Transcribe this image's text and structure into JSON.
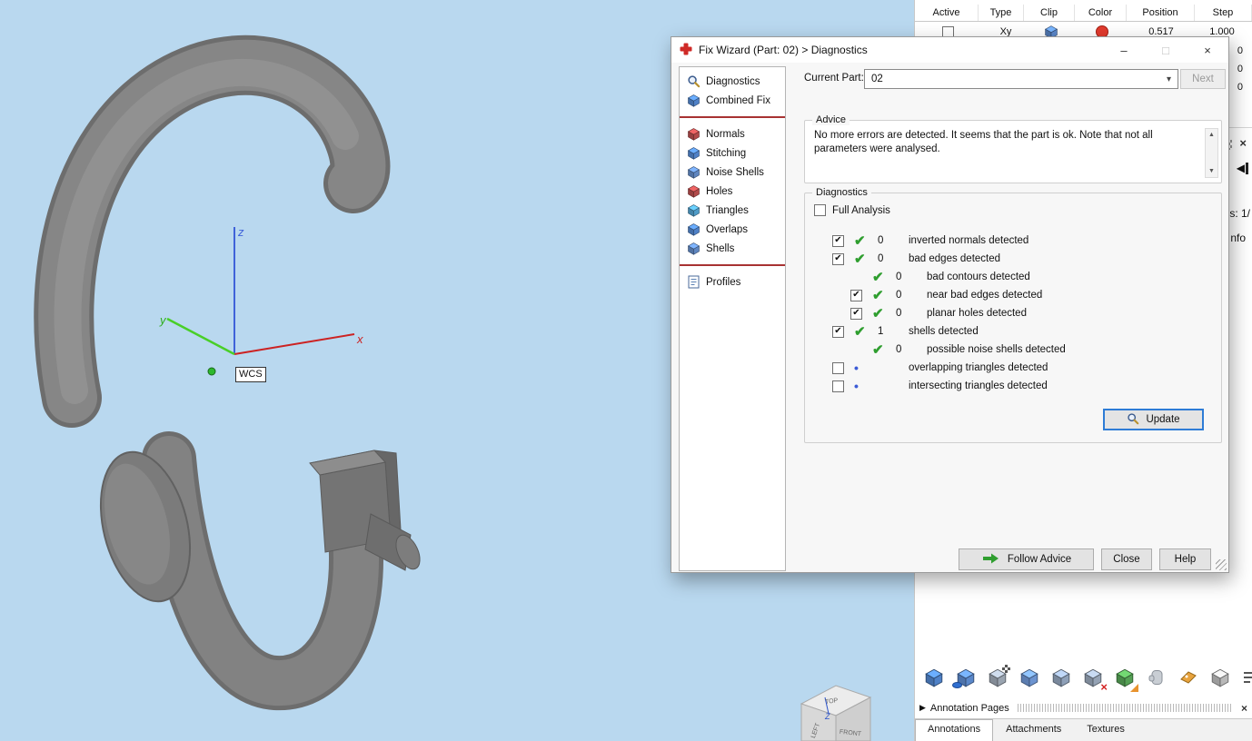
{
  "glyphs": {
    "check": "✔",
    "dot": "•",
    "arrow_left": "◀",
    "close": "×",
    "minimize": "–",
    "maximize": "□",
    "chevron_down": "▾",
    "scroll_up": "▲",
    "scroll_down": "▼",
    "expand_right": "▶"
  },
  "colors": {
    "viewport_bg": "#b9d8ef",
    "accent_blue": "#2e7cd6",
    "check_green": "#2f9e2f",
    "dot_blue": "#3b5bd6",
    "axis_x": "#cc2222",
    "axis_y": "#2fae1f",
    "axis_z": "#3f62d9",
    "swatch_red": "#e23b2e",
    "separator_red": "#a83232",
    "model_gray": "#868686"
  },
  "viewport": {
    "wcs_label": "WCS",
    "axes": {
      "x": "x",
      "y": "y",
      "z": "z"
    },
    "view_cube": {
      "top": "TOP",
      "left": "LEFT",
      "front": "FRONT",
      "z_axis": "Z"
    }
  },
  "dialog": {
    "title": "Fix Wizard (Part: 02) > Diagnostics",
    "current_part": {
      "label": "Current Part:",
      "value": "02"
    },
    "next_button": "Next",
    "sidebar": {
      "top": [
        {
          "label": "Diagnostics",
          "icon": "magnifier-icon"
        },
        {
          "label": "Combined Fix",
          "icon": "combined-fix-icon",
          "color": "#4f81c7"
        }
      ],
      "middle": [
        {
          "label": "Normals",
          "icon": "normals-icon",
          "color": "#b24a4a"
        },
        {
          "label": "Stitching",
          "icon": "stitching-icon",
          "color": "#4f81c7"
        },
        {
          "label": "Noise Shells",
          "icon": "noise-shells-icon",
          "color": "#5f86c0"
        },
        {
          "label": "Holes",
          "icon": "holes-icon",
          "color": "#b24a4a"
        },
        {
          "label": "Triangles",
          "icon": "triangles-icon",
          "color": "#4f9bc7"
        },
        {
          "label": "Overlaps",
          "icon": "overlaps-icon",
          "color": "#4f81c7"
        },
        {
          "label": "Shells",
          "icon": "shells-icon",
          "color": "#5f86c0"
        }
      ],
      "bottom": [
        {
          "label": "Profiles",
          "icon": "profiles-icon"
        }
      ]
    },
    "advice": {
      "legend": "Advice",
      "text": "No more errors are detected. It seems that the part is ok. Note that not all parameters were analysed."
    },
    "diagnostics": {
      "legend": "Diagnostics",
      "full_analysis": "Full Analysis",
      "rows": [
        {
          "checkbox": "checked",
          "mark": "check",
          "count": "0",
          "label": "inverted normals detected",
          "indent": 0
        },
        {
          "checkbox": "checked",
          "mark": "check",
          "count": "0",
          "label": "bad edges detected",
          "indent": 0
        },
        {
          "checkbox": "none",
          "mark": "check",
          "count": "0",
          "label": "bad contours detected",
          "indent": 1
        },
        {
          "checkbox": "checked",
          "mark": "check",
          "count": "0",
          "label": "near bad edges detected",
          "indent": 1
        },
        {
          "checkbox": "checked",
          "mark": "check",
          "count": "0",
          "label": "planar holes detected",
          "indent": 1
        },
        {
          "checkbox": "checked",
          "mark": "check",
          "count": "1",
          "label": "shells detected",
          "indent": 0
        },
        {
          "checkbox": "none",
          "mark": "check",
          "count": "0",
          "label": "possible noise shells detected",
          "indent": 1
        },
        {
          "checkbox": "unchecked",
          "mark": "dot",
          "count": "",
          "label": "overlapping triangles detected",
          "indent": 0
        },
        {
          "checkbox": "unchecked",
          "mark": "dot",
          "count": "",
          "label": "intersecting triangles detected",
          "indent": 0
        }
      ],
      "update_button": "Update"
    },
    "footer": {
      "follow_advice": "Follow Advice",
      "close": "Close",
      "help": "Help"
    }
  },
  "right_panel": {
    "plane_table": {
      "headers": [
        "Active",
        "Type",
        "Clip",
        "Color",
        "Position",
        "Step"
      ],
      "row": {
        "type": "Xy",
        "position": "0.517",
        "step": "1.000"
      },
      "partial_step_values": [
        "0",
        "0",
        "0"
      ]
    },
    "edge": {
      "parts_fragment": "s: 1/",
      "info_fragment": "nfo"
    },
    "annotation_pages": "Annotation Pages",
    "tabs": [
      "Annotations",
      "Attachments",
      "Textures"
    ],
    "toolbar": [
      {
        "name": "import-part-icon",
        "kind": "cube",
        "color": "#4f81c7"
      },
      {
        "name": "view-part-icon",
        "kind": "cube",
        "color": "#5a87c9",
        "badge": "eye"
      },
      {
        "name": "select-triangles-icon",
        "kind": "cube",
        "color": "#9aa4b0",
        "badge": "grid"
      },
      {
        "name": "mark-cube-icon",
        "kind": "cube",
        "color": "#6c93cf"
      },
      {
        "name": "copy-parts-icon",
        "kind": "cube",
        "color": "#8ea0b8"
      },
      {
        "name": "delete-part-icon",
        "kind": "cube",
        "color": "#94a2b4",
        "badge": "x"
      },
      {
        "name": "color-cube-icon",
        "kind": "cube",
        "color": "#55a055",
        "badge": "tri"
      },
      {
        "name": "glove-icon",
        "kind": "glove",
        "color": "#c9ced4"
      },
      {
        "name": "tag-icon",
        "kind": "tag",
        "color": "#e8a33d"
      },
      {
        "name": "box-icon",
        "kind": "cube",
        "color": "#b8b8b8"
      },
      {
        "name": "build-list-icon",
        "kind": "list",
        "color": "#555555"
      }
    ]
  }
}
